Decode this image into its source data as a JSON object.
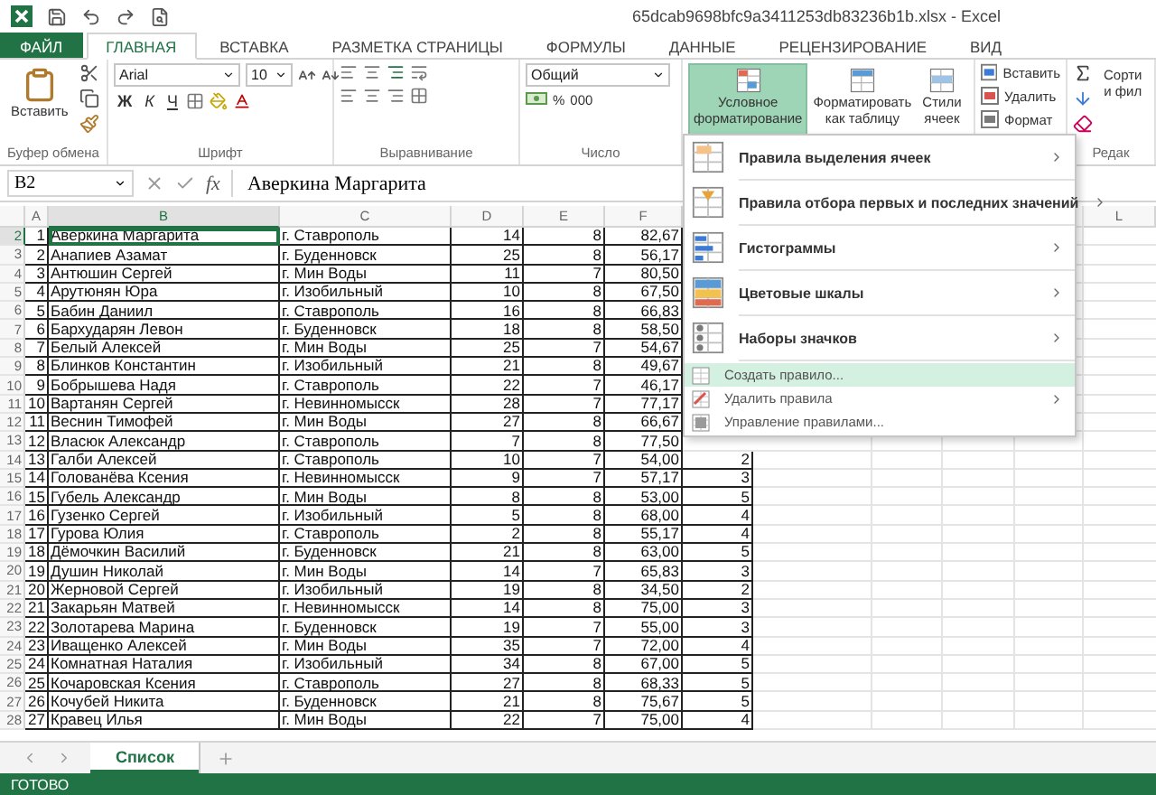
{
  "window": {
    "title": "65dcab9698bfc9a3411253db83236b1b.xlsx - Excel"
  },
  "tabs": [
    {
      "label": "ФАЙЛ",
      "kind": "file",
      "selected": false
    },
    {
      "label": "ГЛАВНАЯ",
      "kind": "tab",
      "selected": true
    },
    {
      "label": "ВСТАВКА",
      "kind": "tab",
      "selected": false
    },
    {
      "label": "РАЗМЕТКА СТРАНИЦЫ",
      "kind": "tab",
      "selected": false
    },
    {
      "label": "ФОРМУЛЫ",
      "kind": "tab",
      "selected": false
    },
    {
      "label": "ДАННЫЕ",
      "kind": "tab",
      "selected": false
    },
    {
      "label": "РЕЦЕНЗИРОВАНИЕ",
      "kind": "tab",
      "selected": false
    },
    {
      "label": "ВИД",
      "kind": "tab",
      "selected": false
    }
  ],
  "ribbon": {
    "clipboard": {
      "paste_label": "Вставить",
      "group_label": "Буфер обмена"
    },
    "font": {
      "font_name": "Arial",
      "font_size": "10",
      "bold": "Ж",
      "italic": "К",
      "underline": "Ч",
      "group_label": "Шрифт"
    },
    "alignment": {
      "group_label": "Выравнивание"
    },
    "number": {
      "format": "Общий",
      "percent": "%",
      "thousands": "000",
      "group_label": "Число"
    },
    "styles": [
      {
        "lines": [
          "Условное",
          "форматирование"
        ],
        "kind": "conditional",
        "expanded": true
      },
      {
        "lines": [
          "Форматировать",
          "как таблицу"
        ],
        "kind": "table",
        "expanded": false
      },
      {
        "lines": [
          "Стили",
          "ячеек"
        ],
        "kind": "cell_styles",
        "expanded": false
      }
    ],
    "cells": [
      {
        "label": "Вставить",
        "kind": "insert"
      },
      {
        "label": "Удалить",
        "kind": "delete"
      },
      {
        "label": "Формат",
        "kind": "format"
      }
    ],
    "editing": {
      "sort_lines": [
        "Сорти",
        "и фил"
      ],
      "group_label": "Редак"
    }
  },
  "formula_bar": {
    "name_box": "B2",
    "function_label": "fx",
    "formula": "Аверкина Маргарита"
  },
  "sheet": {
    "column_headers": [
      {
        "label": "A",
        "selected": false
      },
      {
        "label": "B",
        "selected": true
      },
      {
        "label": "C",
        "selected": false
      },
      {
        "label": "D",
        "selected": false
      },
      {
        "label": "E",
        "selected": false
      },
      {
        "label": "F",
        "selected": false
      }
    ],
    "far_column_header": "L",
    "rows": [
      {
        "header": "2",
        "selected": true,
        "cells": [
          "1",
          "Аверкина Маргарита",
          "г. Ставрополь",
          "14",
          "8",
          "82,67"
        ]
      },
      {
        "header": "3",
        "selected": false,
        "cells": [
          "2",
          "Анапиев Азамат",
          "г. Буденновск",
          "25",
          "8",
          "56,17"
        ]
      },
      {
        "header": "4",
        "selected": false,
        "cells": [
          "3",
          "Антюшин Сергей",
          "г. Мин Воды",
          "11",
          "7",
          "80,50"
        ]
      },
      {
        "header": "5",
        "selected": false,
        "cells": [
          "4",
          "Арутюнян Юра",
          "г. Изобильный",
          "10",
          "8",
          "67,50"
        ]
      },
      {
        "header": "6",
        "selected": false,
        "cells": [
          "5",
          "Бабин Даниил",
          "г. Ставрополь",
          "16",
          "8",
          "66,83"
        ]
      },
      {
        "header": "7",
        "selected": false,
        "cells": [
          "6",
          "Бархударян Левон",
          "г. Буденновск",
          "18",
          "8",
          "58,50"
        ]
      },
      {
        "header": "8",
        "selected": false,
        "cells": [
          "7",
          "Белый Алексей",
          "г. Мин Воды",
          "25",
          "7",
          "54,67"
        ]
      },
      {
        "header": "9",
        "selected": false,
        "cells": [
          "8",
          "Блинков Константин",
          "г. Изобильный",
          "21",
          "8",
          "49,67"
        ]
      },
      {
        "header": "10",
        "selected": false,
        "cells": [
          "9",
          "Бобрышева Надя",
          "г. Ставрополь",
          "22",
          "7",
          "46,17"
        ]
      },
      {
        "header": "11",
        "selected": false,
        "cells": [
          "10",
          "Вартанян Сергей",
          "г. Невинномысск",
          "28",
          "7",
          "77,17"
        ]
      },
      {
        "header": "12",
        "selected": false,
        "cells": [
          "11",
          "Веснин Тимофей",
          "г. Мин Воды",
          "27",
          "8",
          "66,67"
        ]
      },
      {
        "header": "13",
        "selected": false,
        "cells": [
          "12",
          "Власюк Александр",
          "г. Ставрополь",
          "7",
          "8",
          "77,50"
        ]
      },
      {
        "header": "14",
        "selected": false,
        "cells": [
          "13",
          "Галби Алексей",
          "г. Ставрополь",
          "10",
          "7",
          "54,00",
          "2"
        ]
      },
      {
        "header": "15",
        "selected": false,
        "cells": [
          "14",
          "Голованёва Ксения",
          "г. Невинномысск",
          "9",
          "7",
          "57,17",
          "3"
        ]
      },
      {
        "header": "16",
        "selected": false,
        "cells": [
          "15",
          "Губель Александр",
          "г. Мин Воды",
          "8",
          "8",
          "53,00",
          "5"
        ]
      },
      {
        "header": "17",
        "selected": false,
        "cells": [
          "16",
          "Гузенко Сергей",
          "г. Изобильный",
          "5",
          "8",
          "68,00",
          "4"
        ]
      },
      {
        "header": "18",
        "selected": false,
        "cells": [
          "17",
          "Гурова Юлия",
          "г. Ставрополь",
          "2",
          "8",
          "55,17",
          "4"
        ]
      },
      {
        "header": "19",
        "selected": false,
        "cells": [
          "18",
          "Дёмочкин Василий",
          "г. Буденновск",
          "21",
          "8",
          "63,00",
          "5"
        ]
      },
      {
        "header": "20",
        "selected": false,
        "cells": [
          "19",
          "Душин Николай",
          "г. Мин Воды",
          "14",
          "7",
          "65,83",
          "3"
        ]
      },
      {
        "header": "21",
        "selected": false,
        "cells": [
          "20",
          "Жерновой Сергей",
          "г. Изобильный",
          "19",
          "8",
          "34,50",
          "2"
        ]
      },
      {
        "header": "22",
        "selected": false,
        "cells": [
          "21",
          "Закарьян Матвей",
          "г. Невинномысск",
          "14",
          "8",
          "75,00",
          "3"
        ]
      },
      {
        "header": "23",
        "selected": false,
        "cells": [
          "22",
          "Золотарева Марина",
          "г. Буденновск",
          "19",
          "7",
          "55,00",
          "3"
        ]
      },
      {
        "header": "24",
        "selected": false,
        "cells": [
          "23",
          "Иващенко Алексей",
          "г. Мин Воды",
          "35",
          "7",
          "72,00",
          "4"
        ]
      },
      {
        "header": "25",
        "selected": false,
        "cells": [
          "24",
          "Комнатная Наталия",
          "г. Изобильный",
          "34",
          "8",
          "67,00",
          "5"
        ]
      },
      {
        "header": "26",
        "selected": false,
        "cells": [
          "25",
          "Кочаровская Ксения",
          "г. Ставрополь",
          "27",
          "8",
          "68,33",
          "5"
        ]
      },
      {
        "header": "27",
        "selected": false,
        "cells": [
          "26",
          "Кочубей Никита",
          "г. Буденновск",
          "21",
          "8",
          "75,67",
          "5"
        ]
      },
      {
        "header": "28",
        "selected": false,
        "cells": [
          "27",
          "Кравец Илья",
          "г. Мин Воды",
          "22",
          "7",
          "75,00",
          "4"
        ]
      }
    ]
  },
  "menu": {
    "items": [
      {
        "label": "Правила выделения ячеек",
        "kind": "large",
        "submenu": true,
        "selected": false
      },
      {
        "label": "Правила отбора первых и последних значений",
        "kind": "large",
        "submenu": true,
        "selected": false
      },
      {
        "label": "Гистограммы",
        "kind": "large",
        "submenu": true,
        "selected": false
      },
      {
        "label": "Цветовые шкалы",
        "kind": "large",
        "submenu": true,
        "selected": false
      },
      {
        "label": "Наборы значков",
        "kind": "large",
        "submenu": true,
        "selected": false
      },
      {
        "label": "Создать правило...",
        "kind": "small",
        "submenu": false,
        "selected": true
      },
      {
        "label": "Удалить правила",
        "kind": "small",
        "submenu": true,
        "selected": false
      },
      {
        "label": "Управление правилами...",
        "kind": "small",
        "submenu": false,
        "selected": false
      }
    ]
  },
  "sheet_tabs": [
    {
      "label": "Список",
      "selected": true
    }
  ],
  "status_bar": {
    "text": "ГОТОВО"
  }
}
